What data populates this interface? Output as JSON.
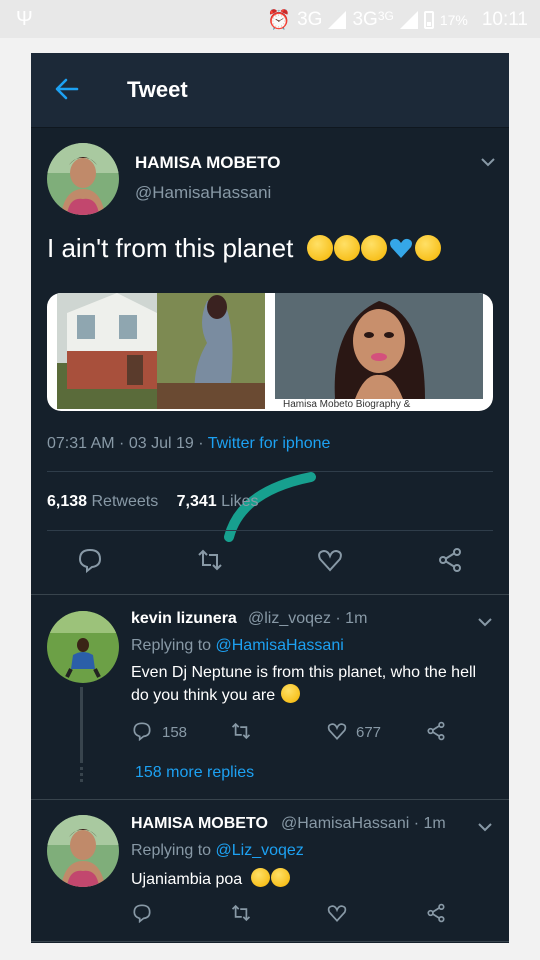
{
  "statusbar": {
    "network1": "3G",
    "network2": "3G",
    "network2_sup": "3G",
    "battery": "17%",
    "time": "10:11"
  },
  "header": {
    "title": "Tweet"
  },
  "tweet": {
    "author_name": "HAMISA MOBETO",
    "author_handle": "@HamisaHassani",
    "text": "I ain't from this planet",
    "emojis": [
      "grinning-face-icon",
      "grinning-face-icon",
      "heart-eyes-icon",
      "blue-heart-icon",
      "kissing-heart-icon"
    ],
    "card_caption": "Hamisa Mobeto Biography &",
    "time": "07:31 AM · 03 Jul 19 · ",
    "source": "Twitter for iphone",
    "retweets_count": "6,138",
    "retweets_label": "Retweets",
    "likes_count": "7,341",
    "likes_label": "Likes"
  },
  "replies": [
    {
      "name": "kevin lizunera",
      "handle": "@liz_voqez · 1m",
      "replying_prefix": "Replying to ",
      "replying_to": "@HamisaHassani",
      "text": "Even Dj Neptune is from this planet, who the hell do you think you are",
      "reply_count": "158",
      "like_count": "677",
      "more_replies": "158 more replies"
    },
    {
      "name": "HAMISA MOBETO",
      "handle": "@HamisaHassani · 1m",
      "replying_prefix": "Replying to ",
      "replying_to": "@Liz_voqez",
      "text": "Ujaniambia poa"
    }
  ],
  "colors": {
    "background": "#15202b",
    "header": "#1c2938",
    "accent": "#1da1f2",
    "muted": "#8899a6",
    "swoosh": "#17a08f"
  }
}
